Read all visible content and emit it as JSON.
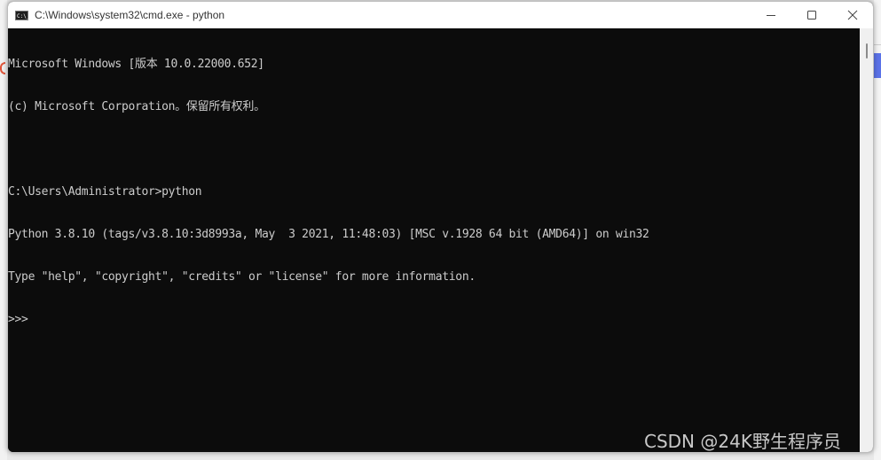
{
  "window": {
    "title": "C:\\Windows\\system32\\cmd.exe - python",
    "app_icon_text": "C:\\_",
    "controls": {
      "minimize": "—",
      "maximize": "☐",
      "close": "✕"
    }
  },
  "terminal": {
    "lines": [
      "Microsoft Windows [版本 10.0.22000.652]",
      "(c) Microsoft Corporation。保留所有权利。",
      "",
      "C:\\Users\\Administrator>python",
      "Python 3.8.10 (tags/v3.8.10:3d8993a, May  3 2021, 11:48:03) [MSC v.1928 64 bit (AMD64)] on win32",
      "Type \"help\", \"copyright\", \"credits\" or \"license\" for more information.",
      ">>> "
    ]
  },
  "watermark": "CSDN @24K野生程序员",
  "colors": {
    "terminal_bg": "#0c0c0c",
    "terminal_fg": "#cccccc",
    "titlebar_bg": "#ffffff"
  }
}
